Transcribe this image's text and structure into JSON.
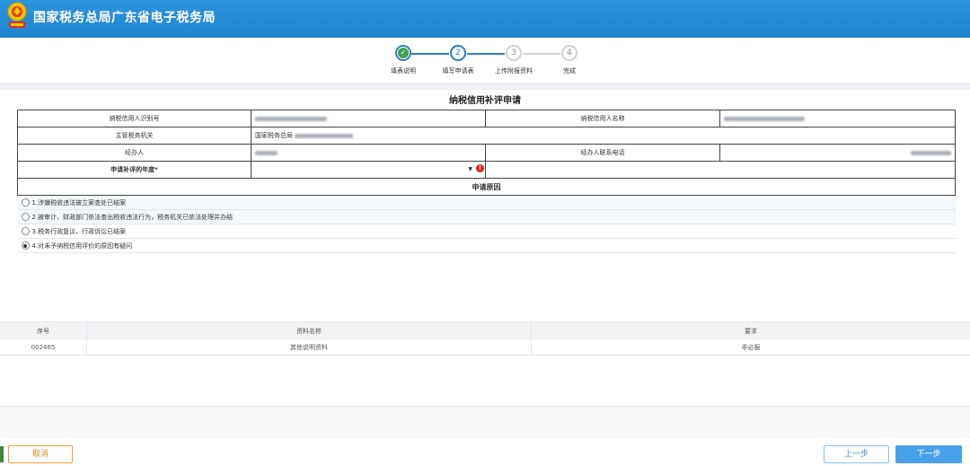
{
  "header": {
    "title": "国家税务总局广东省电子税务局",
    "logo_icon": "tax-emblem-icon"
  },
  "steps": [
    {
      "number": "✓",
      "label": "填表说明",
      "state": "done"
    },
    {
      "number": "2",
      "label": "填写申请表",
      "state": "active"
    },
    {
      "number": "3",
      "label": "上传附报资料",
      "state": "pending"
    },
    {
      "number": "4",
      "label": "完成",
      "state": "pending"
    }
  ],
  "form": {
    "title": "纳税信用补评申请",
    "taxpayer_id_label": "纳税信用人识别号",
    "taxpayer_name_label": "纳税信用人名称",
    "tax_authority_label": "主管税务机关",
    "tax_authority_value": "国家税务总局",
    "handler_label": "经办人",
    "handler_phone_label": "经办人联系电话",
    "year_label": "申请补评的年度*",
    "year_value": "",
    "reason_header": "申请原因",
    "reasons": [
      {
        "label": "1.涉嫌税收违法被立案查处已结案",
        "selected": false
      },
      {
        "label": "2.被审计、财政部门依法查出税收违法行为，税务机关已依法处理并办结",
        "selected": false
      },
      {
        "label": "3.税务行政复议、行政诉讼已结案",
        "selected": false
      },
      {
        "label": "4.对未予纳税信用评价的原因有疑问",
        "selected": true
      }
    ]
  },
  "attachments": {
    "columns": [
      "序号",
      "资料名称",
      "要求"
    ],
    "rows": [
      [
        "002465",
        "其他说明资料",
        "非必报"
      ]
    ]
  },
  "footer": {
    "cancel_label": "取消",
    "prev_label": "上一步",
    "next_label": "下一步"
  },
  "colors": {
    "brand_blue": "#1f84cf",
    "step_blue": "#2b7fc8",
    "cancel_orange": "#e08a20",
    "error_red": "#e02020"
  }
}
